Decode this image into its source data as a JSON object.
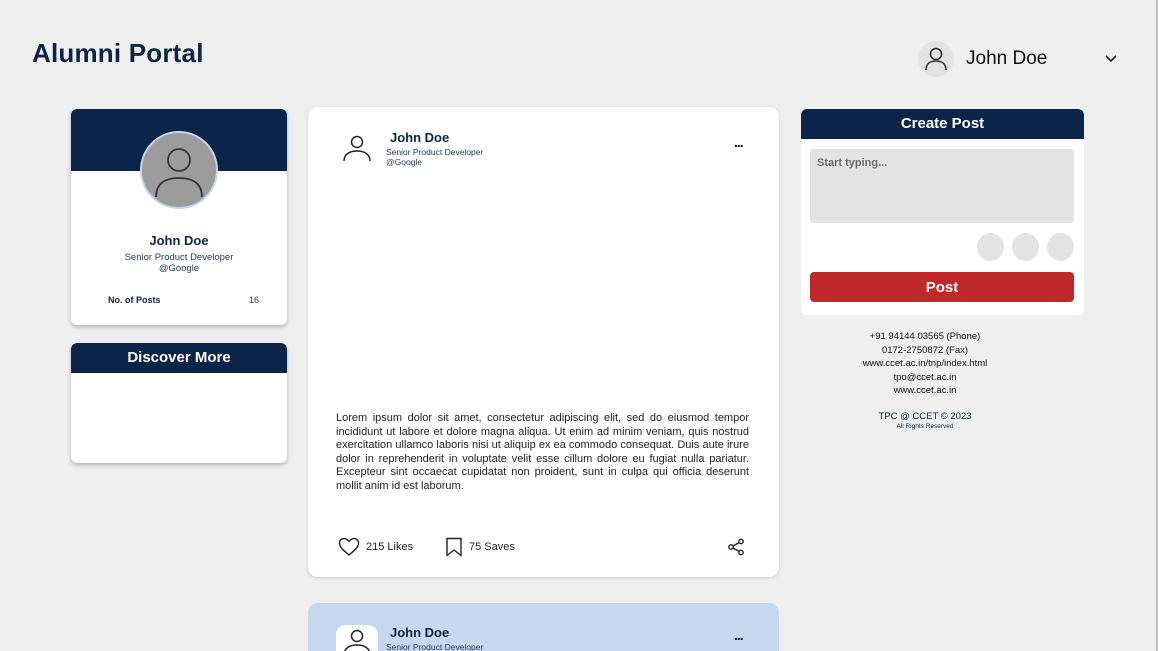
{
  "app": {
    "title": "Alumni Portal"
  },
  "header": {
    "user_name": "John Doe"
  },
  "profile": {
    "name": "John Doe",
    "role": "Senior Product Developer",
    "org": "@Google",
    "posts_label": "No. of Posts",
    "posts_count": "16"
  },
  "discover": {
    "title": "Discover More"
  },
  "post": {
    "author": "John Doe",
    "role": "Senior Product Developer",
    "org": "@Google",
    "more": "...",
    "body": "Lorem ipsum dolor sit amet, consectetur adipiscing elit, sed do eiusmod tempor incididunt ut labore et dolore magna aliqua. Ut enim ad minim veniam, quis nostrud exercitation ullamco laboris nisi ut aliquip ex ea commodo consequat. Duis aute irure dolor in reprehenderit in voluptate velit esse cillum dolore eu fugiat nulla pariatur. Excepteur sint occaecat cupidatat non proident, sunt in culpa qui officia deserunt mollit anim id est laborum.",
    "likes": "215 Likes",
    "saves": "75 Saves"
  },
  "post2": {
    "author": "John Doe",
    "role": "Senior Product Developer",
    "more": "..."
  },
  "create": {
    "title": "Create Post",
    "placeholder": "Start typing...",
    "button": "Post"
  },
  "footer": {
    "phone": "+91 94144 03565 (Phone)",
    "fax": "0172-2750872 (Fax)",
    "url1": "www.ccet.ac.in/tnp/index.html",
    "email": "tpo@ccet.ac.in",
    "url2": "www.ccet.ac.in",
    "copyright": "TPC @ CCET © 2023",
    "rights": "All Rights Reserved"
  },
  "colors": {
    "navy": "#0b2447",
    "red": "#c0282b",
    "light_blue": "#c6d8ef",
    "background": "#efefef"
  }
}
